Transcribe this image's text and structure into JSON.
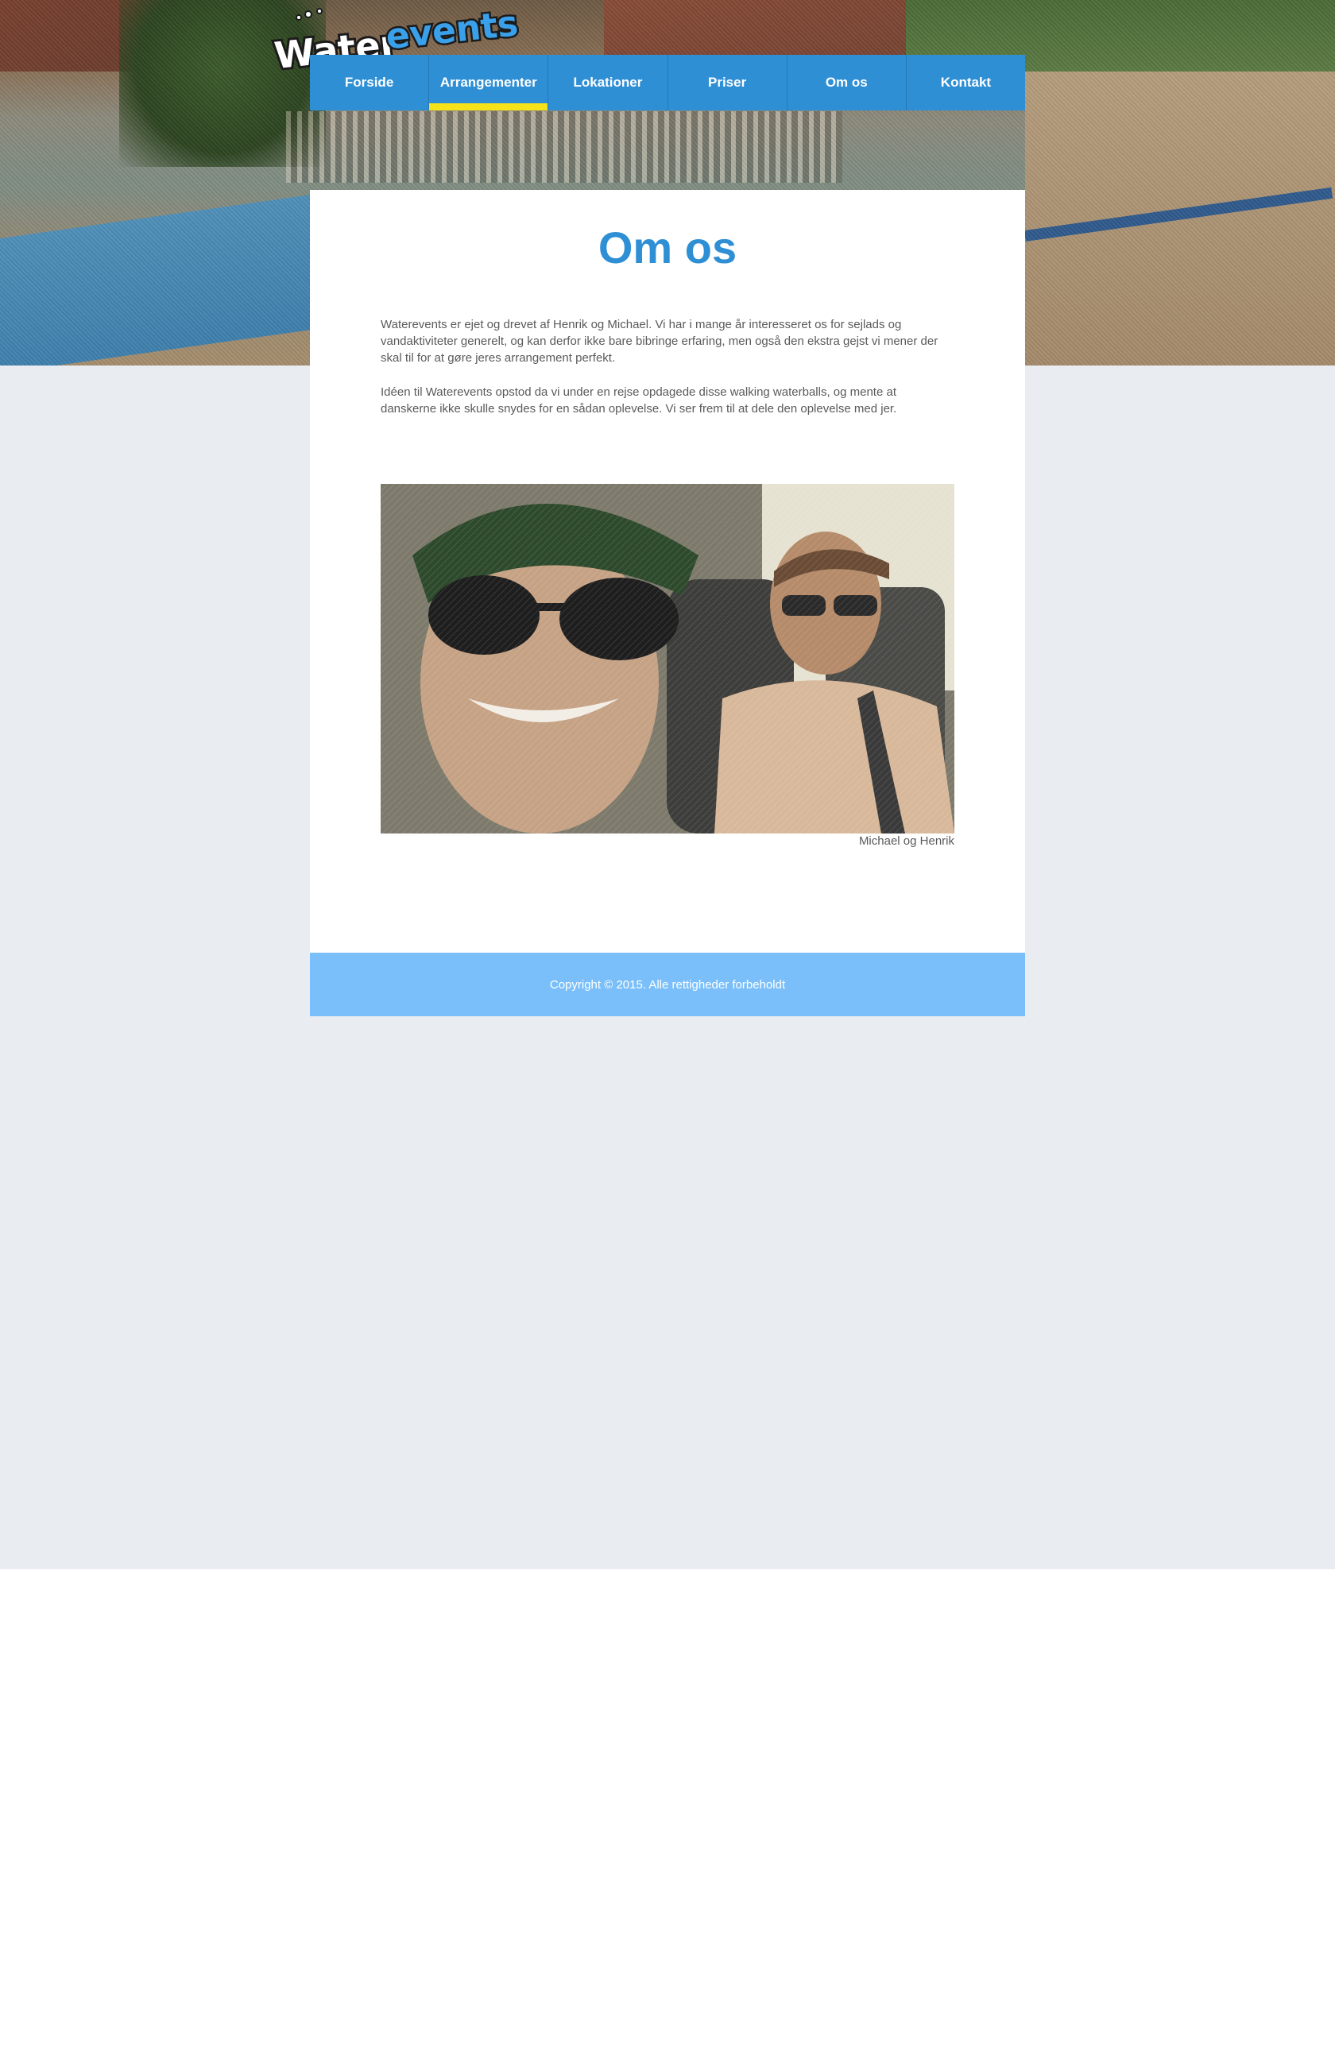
{
  "brand": {
    "logo_text_part1": "Water",
    "logo_text_part2": "events",
    "primary_color": "#2f8fd5",
    "accent_color": "#f5e21a",
    "footer_color": "#7abffa",
    "background_color": "#e9ecf0"
  },
  "nav": {
    "items": [
      {
        "label": "Forside"
      },
      {
        "label": "Arrangementer",
        "active": true
      },
      {
        "label": "Lokationer"
      },
      {
        "label": "Priser"
      },
      {
        "label": "Om os"
      },
      {
        "label": "Kontakt"
      }
    ]
  },
  "main": {
    "title": "Om os",
    "paragraph1": "Waterevents er ejet og drevet af Henrik og Michael. Vi har i mange år interesseret os for sejlads og vandaktiviteter generelt, og kan derfor ikke bare bibringe erfaring, men også den ekstra gejst vi mener der skal til for at gøre jeres arrangement perfekt.",
    "paragraph2": "Idéen til Waterevents opstod da vi under en rejse opdagede disse walking waterballs, og mente at danskerne ikke skulle snydes for en sådan oplevelse. Vi ser frem til at dele den oplevelse med jer.",
    "photo_caption": "Michael og Henrik"
  },
  "footer": {
    "copyright": "Copyright © 2015. Alle rettigheder forbeholdt"
  }
}
